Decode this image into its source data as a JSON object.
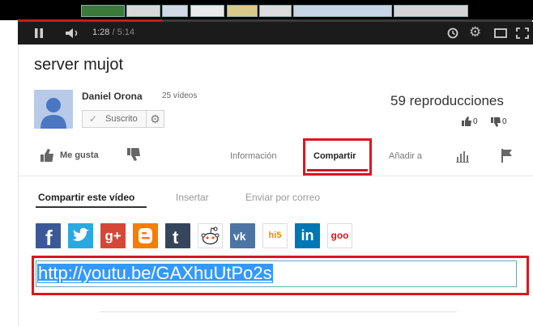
{
  "player": {
    "current_time": "1:28",
    "duration": "/ 5:14",
    "progress_fraction": 0.28
  },
  "video": {
    "title": "server mujot",
    "channel_name": "Daniel Orona",
    "channel_video_count": "25 vídeos",
    "subscribe_label": "Suscrito",
    "views": "59 reproducciones",
    "like_count": "0",
    "dislike_count": "0"
  },
  "actions": {
    "like_label": "Me gusta",
    "tabs": {
      "info": "Información",
      "share": "Compartir",
      "add": "Añadir a"
    }
  },
  "share": {
    "subtabs": {
      "share_video": "Compartir este vídeo",
      "embed": "Insertar",
      "email": "Enviar por correo"
    },
    "social_labels": {
      "googleplus": "g+",
      "hi5": "hi5",
      "linkedin": "in",
      "goo": "goo"
    },
    "url": "http://youtu.be/GAXhuUtPo2s"
  },
  "colors": {
    "accent_red": "#cc181e",
    "highlight_red": "#e0141e",
    "selection_blue": "#3399ff"
  }
}
